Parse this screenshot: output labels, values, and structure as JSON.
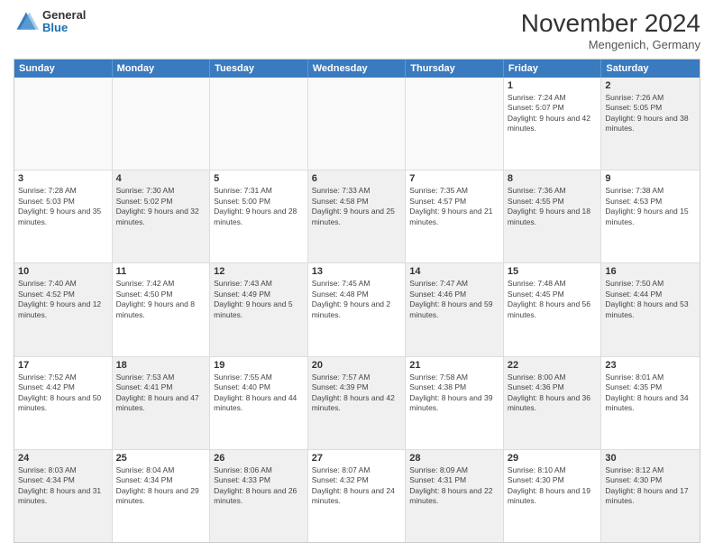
{
  "header": {
    "logo": {
      "general": "General",
      "blue": "Blue"
    },
    "month": "November 2024",
    "location": "Mengenich, Germany"
  },
  "days": [
    "Sunday",
    "Monday",
    "Tuesday",
    "Wednesday",
    "Thursday",
    "Friday",
    "Saturday"
  ],
  "rows": [
    [
      {
        "day": "",
        "text": "",
        "empty": true
      },
      {
        "day": "",
        "text": "",
        "empty": true
      },
      {
        "day": "",
        "text": "",
        "empty": true
      },
      {
        "day": "",
        "text": "",
        "empty": true
      },
      {
        "day": "",
        "text": "",
        "empty": true
      },
      {
        "day": "1",
        "text": "Sunrise: 7:24 AM\nSunset: 5:07 PM\nDaylight: 9 hours and 42 minutes."
      },
      {
        "day": "2",
        "text": "Sunrise: 7:26 AM\nSunset: 5:05 PM\nDaylight: 9 hours and 38 minutes.",
        "shaded": true
      }
    ],
    [
      {
        "day": "3",
        "text": "Sunrise: 7:28 AM\nSunset: 5:03 PM\nDaylight: 9 hours and 35 minutes."
      },
      {
        "day": "4",
        "text": "Sunrise: 7:30 AM\nSunset: 5:02 PM\nDaylight: 9 hours and 32 minutes.",
        "shaded": true
      },
      {
        "day": "5",
        "text": "Sunrise: 7:31 AM\nSunset: 5:00 PM\nDaylight: 9 hours and 28 minutes."
      },
      {
        "day": "6",
        "text": "Sunrise: 7:33 AM\nSunset: 4:58 PM\nDaylight: 9 hours and 25 minutes.",
        "shaded": true
      },
      {
        "day": "7",
        "text": "Sunrise: 7:35 AM\nSunset: 4:57 PM\nDaylight: 9 hours and 21 minutes."
      },
      {
        "day": "8",
        "text": "Sunrise: 7:36 AM\nSunset: 4:55 PM\nDaylight: 9 hours and 18 minutes.",
        "shaded": true
      },
      {
        "day": "9",
        "text": "Sunrise: 7:38 AM\nSunset: 4:53 PM\nDaylight: 9 hours and 15 minutes."
      }
    ],
    [
      {
        "day": "10",
        "text": "Sunrise: 7:40 AM\nSunset: 4:52 PM\nDaylight: 9 hours and 12 minutes.",
        "shaded": true
      },
      {
        "day": "11",
        "text": "Sunrise: 7:42 AM\nSunset: 4:50 PM\nDaylight: 9 hours and 8 minutes."
      },
      {
        "day": "12",
        "text": "Sunrise: 7:43 AM\nSunset: 4:49 PM\nDaylight: 9 hours and 5 minutes.",
        "shaded": true
      },
      {
        "day": "13",
        "text": "Sunrise: 7:45 AM\nSunset: 4:48 PM\nDaylight: 9 hours and 2 minutes."
      },
      {
        "day": "14",
        "text": "Sunrise: 7:47 AM\nSunset: 4:46 PM\nDaylight: 8 hours and 59 minutes.",
        "shaded": true
      },
      {
        "day": "15",
        "text": "Sunrise: 7:48 AM\nSunset: 4:45 PM\nDaylight: 8 hours and 56 minutes."
      },
      {
        "day": "16",
        "text": "Sunrise: 7:50 AM\nSunset: 4:44 PM\nDaylight: 8 hours and 53 minutes.",
        "shaded": true
      }
    ],
    [
      {
        "day": "17",
        "text": "Sunrise: 7:52 AM\nSunset: 4:42 PM\nDaylight: 8 hours and 50 minutes."
      },
      {
        "day": "18",
        "text": "Sunrise: 7:53 AM\nSunset: 4:41 PM\nDaylight: 8 hours and 47 minutes.",
        "shaded": true
      },
      {
        "day": "19",
        "text": "Sunrise: 7:55 AM\nSunset: 4:40 PM\nDaylight: 8 hours and 44 minutes."
      },
      {
        "day": "20",
        "text": "Sunrise: 7:57 AM\nSunset: 4:39 PM\nDaylight: 8 hours and 42 minutes.",
        "shaded": true
      },
      {
        "day": "21",
        "text": "Sunrise: 7:58 AM\nSunset: 4:38 PM\nDaylight: 8 hours and 39 minutes."
      },
      {
        "day": "22",
        "text": "Sunrise: 8:00 AM\nSunset: 4:36 PM\nDaylight: 8 hours and 36 minutes.",
        "shaded": true
      },
      {
        "day": "23",
        "text": "Sunrise: 8:01 AM\nSunset: 4:35 PM\nDaylight: 8 hours and 34 minutes."
      }
    ],
    [
      {
        "day": "24",
        "text": "Sunrise: 8:03 AM\nSunset: 4:34 PM\nDaylight: 8 hours and 31 minutes.",
        "shaded": true
      },
      {
        "day": "25",
        "text": "Sunrise: 8:04 AM\nSunset: 4:34 PM\nDaylight: 8 hours and 29 minutes."
      },
      {
        "day": "26",
        "text": "Sunrise: 8:06 AM\nSunset: 4:33 PM\nDaylight: 8 hours and 26 minutes.",
        "shaded": true
      },
      {
        "day": "27",
        "text": "Sunrise: 8:07 AM\nSunset: 4:32 PM\nDaylight: 8 hours and 24 minutes."
      },
      {
        "day": "28",
        "text": "Sunrise: 8:09 AM\nSunset: 4:31 PM\nDaylight: 8 hours and 22 minutes.",
        "shaded": true
      },
      {
        "day": "29",
        "text": "Sunrise: 8:10 AM\nSunset: 4:30 PM\nDaylight: 8 hours and 19 minutes."
      },
      {
        "day": "30",
        "text": "Sunrise: 8:12 AM\nSunset: 4:30 PM\nDaylight: 8 hours and 17 minutes.",
        "shaded": true
      }
    ]
  ]
}
